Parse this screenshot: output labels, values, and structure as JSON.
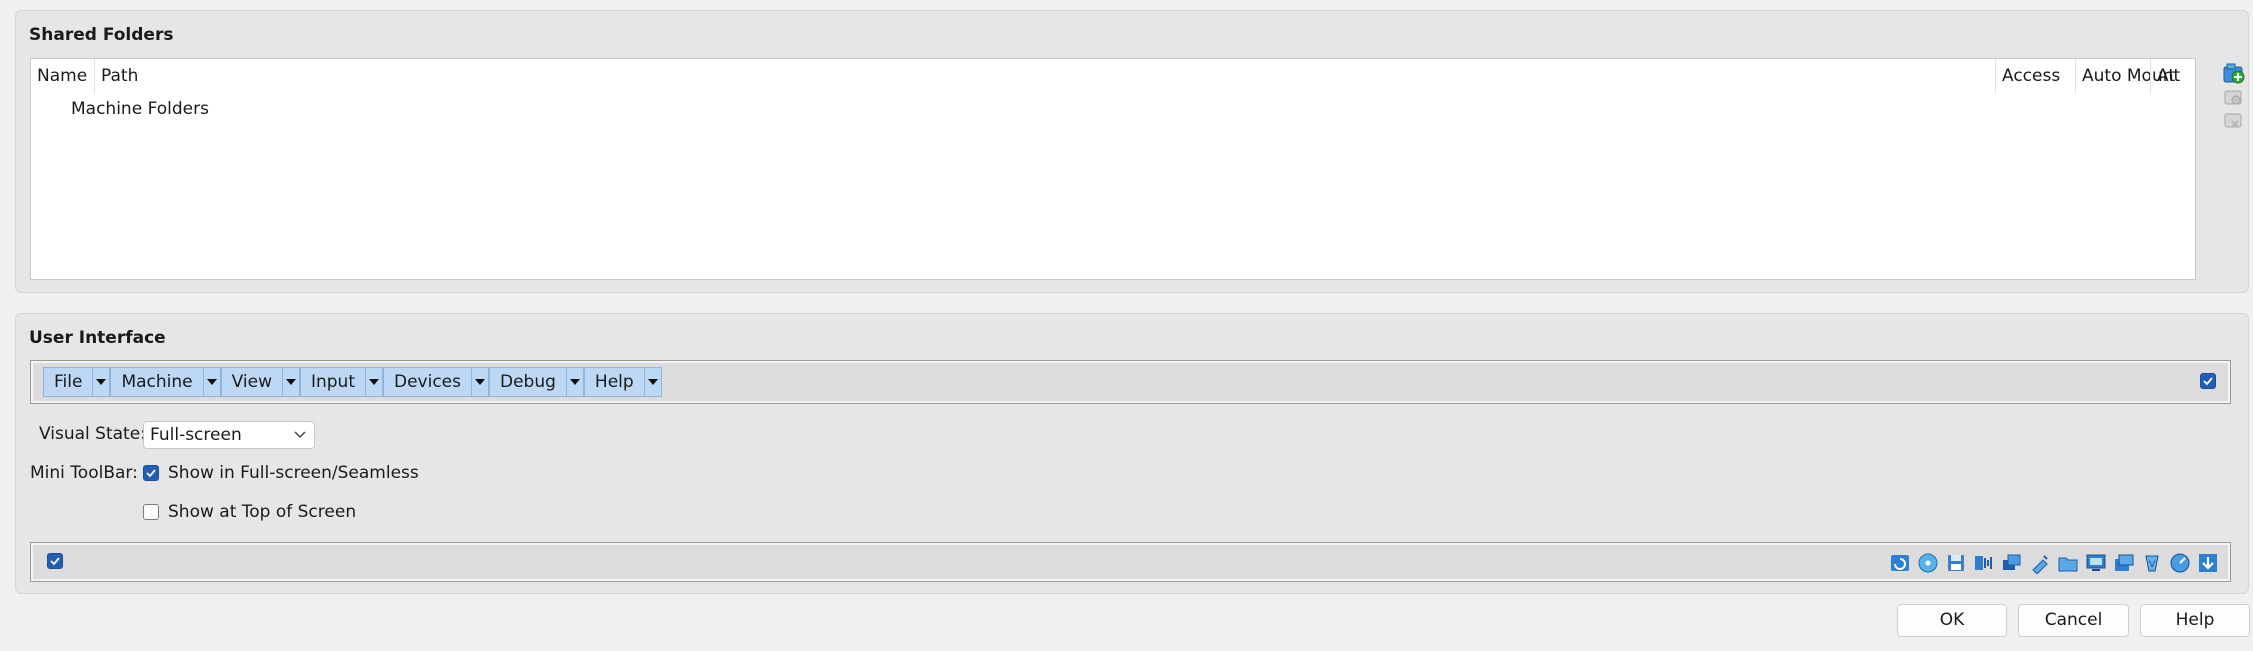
{
  "shared_folders": {
    "title": "Shared Folders",
    "columns": [
      "Name",
      "Path",
      "Access",
      "Auto Mount",
      "At"
    ],
    "tree_rows": [
      "Machine Folders"
    ],
    "actions": [
      "add-shared-folder-icon",
      "edit-shared-folder-icon",
      "remove-shared-folder-icon"
    ]
  },
  "user_interface": {
    "title": "User Interface",
    "menubar": {
      "items": [
        "File",
        "Machine",
        "View",
        "Input",
        "Devices",
        "Debug",
        "Help"
      ],
      "enabled": true
    },
    "visual_state": {
      "label": "Visual State:",
      "value": "Full-screen"
    },
    "mini_toolbar": {
      "label": "Mini ToolBar:",
      "show_fullscreen": {
        "label": "Show in Full-screen/Seamless",
        "checked": true
      },
      "show_top": {
        "label": "Show at Top of Screen",
        "checked": false
      }
    },
    "statusbar": {
      "enabled": true,
      "icons": [
        "hard-disk-icon",
        "optical-disk-icon",
        "floppy-disk-icon",
        "audio-icon",
        "network-icon",
        "usb-icon",
        "shared-folders-icon",
        "display-icon",
        "video-capture-icon",
        "graphics-icon",
        "cpu-icon",
        "mouse-icon",
        "keyboard-icon"
      ]
    }
  },
  "buttons": {
    "ok": "OK",
    "cancel": "Cancel",
    "help": "Help"
  },
  "colors": {
    "accent": "#1f5fb8",
    "menu_bg": "#bcd8f5"
  }
}
